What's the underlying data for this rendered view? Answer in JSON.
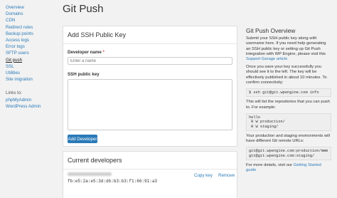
{
  "sidebar": {
    "items": [
      "Overview",
      "Domains",
      "CDN",
      "Redirect rules",
      "Backup points",
      "Access logs",
      "Error logs",
      "SFTP users",
      "Git push",
      "SSL",
      "Utilities",
      "Site migration"
    ],
    "links_label": "Links to:",
    "links": [
      "phpMyAdmin",
      "WordPress Admin"
    ]
  },
  "page": {
    "title": "Git Push"
  },
  "add_key": {
    "title": "Add SSH Public Key",
    "name_label": "Developer name",
    "required_mark": "*",
    "name_placeholder": "Enter a name",
    "key_label": "SSH public key",
    "button": "Add Developer"
  },
  "developers": {
    "title": "Current developers",
    "rows": [
      {
        "fingerprint": "fb:e5:2a:e5:3d:db:b3:b3:f1:66:91:a3",
        "copy": "Copy key",
        "remove": "Remove"
      }
    ]
  },
  "overview": {
    "title": "Git Push Overview",
    "intro": "Submit your SSH public key along with username here. If you need help generating an SSH public key or setting up Git Push integration with WP Engine, please visit this",
    "support_link": "Support Garage article",
    "after_save": "Once you save your key successfully you should see it to the left. The key will be effectively published in about 10 minutes. To confirm connectivity:",
    "cmd": "$ ssh git@git.wpengine.com info",
    "list_text": "This will list the repositories that you can push to. For example:",
    "sample": "hello\n R W production/\n R W staging/",
    "env_text": "Your production and staging environments will have different Git remote URLs:",
    "remotes": "git@git.wpengine.com:production/mmm\ngit@git.wpengine.com:staging/",
    "more_text": "For more details, visit our",
    "more_link": "Getting Started guide"
  }
}
